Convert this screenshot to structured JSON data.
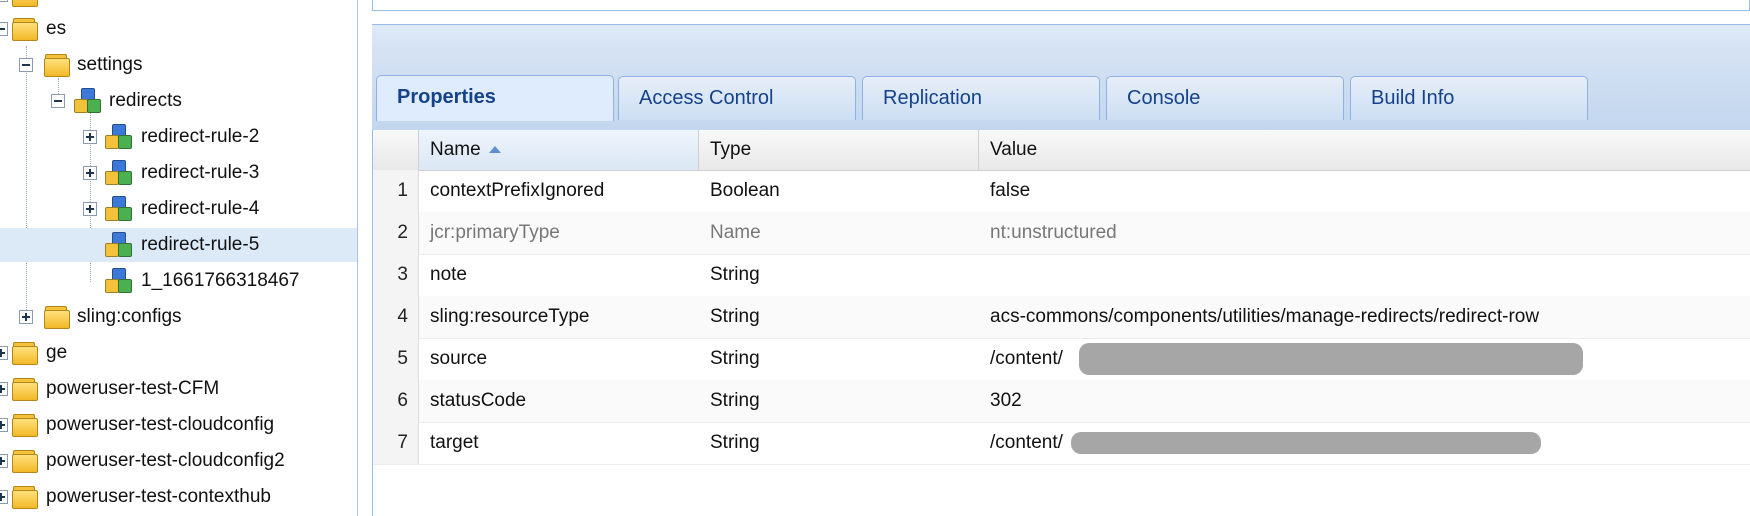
{
  "tree": {
    "items": [
      {
        "label": "es"
      },
      {
        "label": "settings"
      },
      {
        "label": "redirects"
      },
      {
        "label": "redirect-rule-2"
      },
      {
        "label": "redirect-rule-3"
      },
      {
        "label": "redirect-rule-4"
      },
      {
        "label": "redirect-rule-5",
        "selected": true
      },
      {
        "label": "1_1661766318467"
      },
      {
        "label": "sling:configs"
      },
      {
        "label": "ge"
      },
      {
        "label": "poweruser-test-CFM"
      },
      {
        "label": "poweruser-test-cloudconfig"
      },
      {
        "label": "poweruser-test-cloudconfig2"
      },
      {
        "label": "poweruser-test-contexthub"
      }
    ]
  },
  "tabs": [
    "Properties",
    "Access Control",
    "Replication",
    "Console",
    "Build Info"
  ],
  "grid": {
    "columns": {
      "name": "Name",
      "type": "Type",
      "value": "Value"
    },
    "sort_column": "Name",
    "rows": [
      {
        "num": "1",
        "name": "contextPrefixIgnored",
        "type": "Boolean",
        "value": "false"
      },
      {
        "num": "2",
        "name": "jcr:primaryType",
        "type": "Name",
        "value": "nt:unstructured"
      },
      {
        "num": "3",
        "name": "note",
        "type": "String",
        "value": ""
      },
      {
        "num": "4",
        "name": "sling:resourceType",
        "type": "String",
        "value": "acs-commons/components/utilities/manage-redirects/redirect-row"
      },
      {
        "num": "5",
        "name": "source",
        "type": "String",
        "value": "/content/"
      },
      {
        "num": "6",
        "name": "statusCode",
        "type": "String",
        "value": "302"
      },
      {
        "num": "7",
        "name": "target",
        "type": "String",
        "value": "/content/"
      }
    ]
  },
  "colors": {
    "accent": "#15428b",
    "selection": "#dce9f7",
    "border": "#99bbe8"
  }
}
